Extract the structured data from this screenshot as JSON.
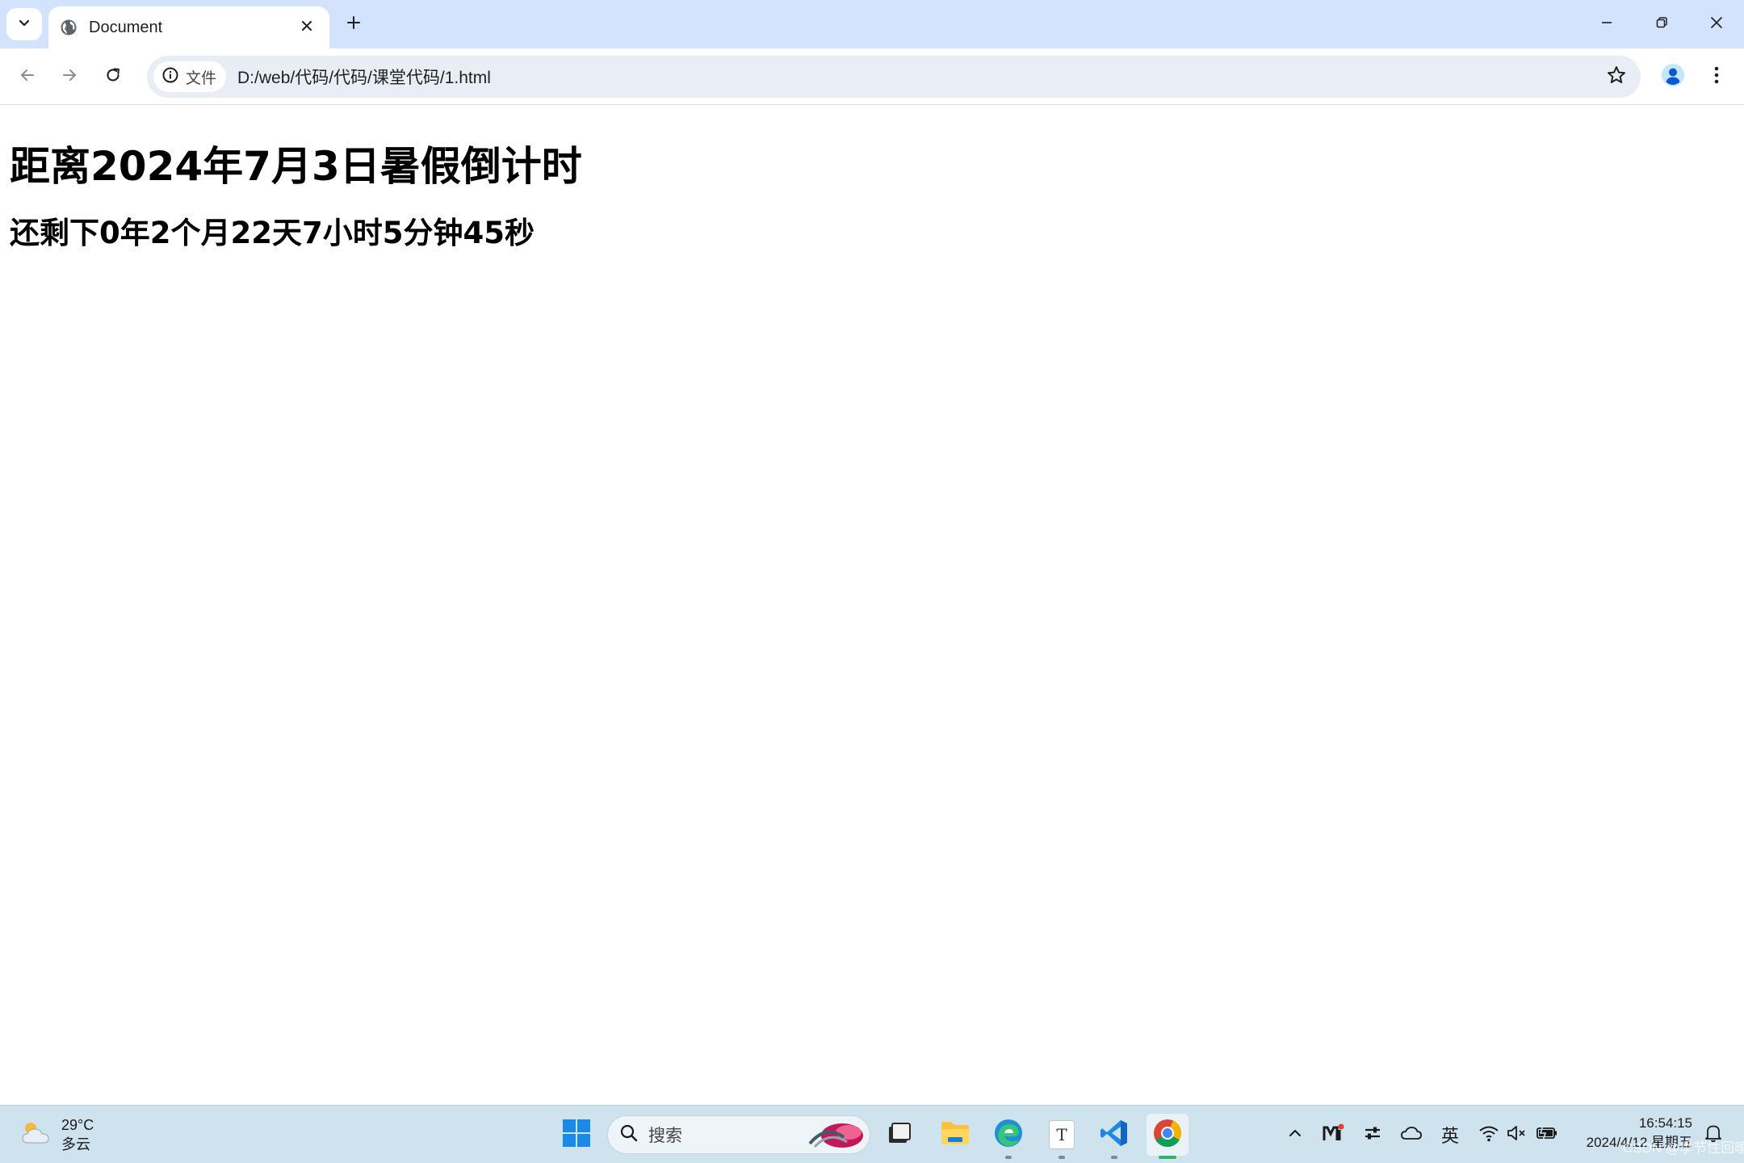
{
  "browser": {
    "tab": {
      "title": "Document"
    },
    "address_bar": {
      "site_chip_label": "文件",
      "url": "D:/web/代码/代码/课堂代码/1.html"
    }
  },
  "page": {
    "heading": "距离2024年7月3日暑假倒计时",
    "countdown": "还剩下0年2个月22天7小时5分钟45秒"
  },
  "taskbar": {
    "weather": {
      "temperature": "29°C",
      "condition": "多云"
    },
    "search": {
      "placeholder": "搜索"
    },
    "apps": [
      {
        "name": "start-button-icon"
      },
      {
        "name": "task-view-icon"
      },
      {
        "name": "file-explorer-icon"
      },
      {
        "name": "edge-icon"
      },
      {
        "name": "typora-icon",
        "label": "T"
      },
      {
        "name": "vscode-icon"
      },
      {
        "name": "chrome-icon"
      }
    ],
    "tray": {
      "input_method": "英",
      "time": "16:54:15",
      "date": "2024/4/12 星期五"
    },
    "watermark": "CSDN @季节性回暖"
  },
  "colors": {
    "tabstrip_bg": "#d3e3fd",
    "omnibox_bg": "#e9eef6",
    "taskbar_bg": "#cfe3ee",
    "profile_blue": "#0b57d0",
    "chrome_green": "#2fb36b"
  }
}
